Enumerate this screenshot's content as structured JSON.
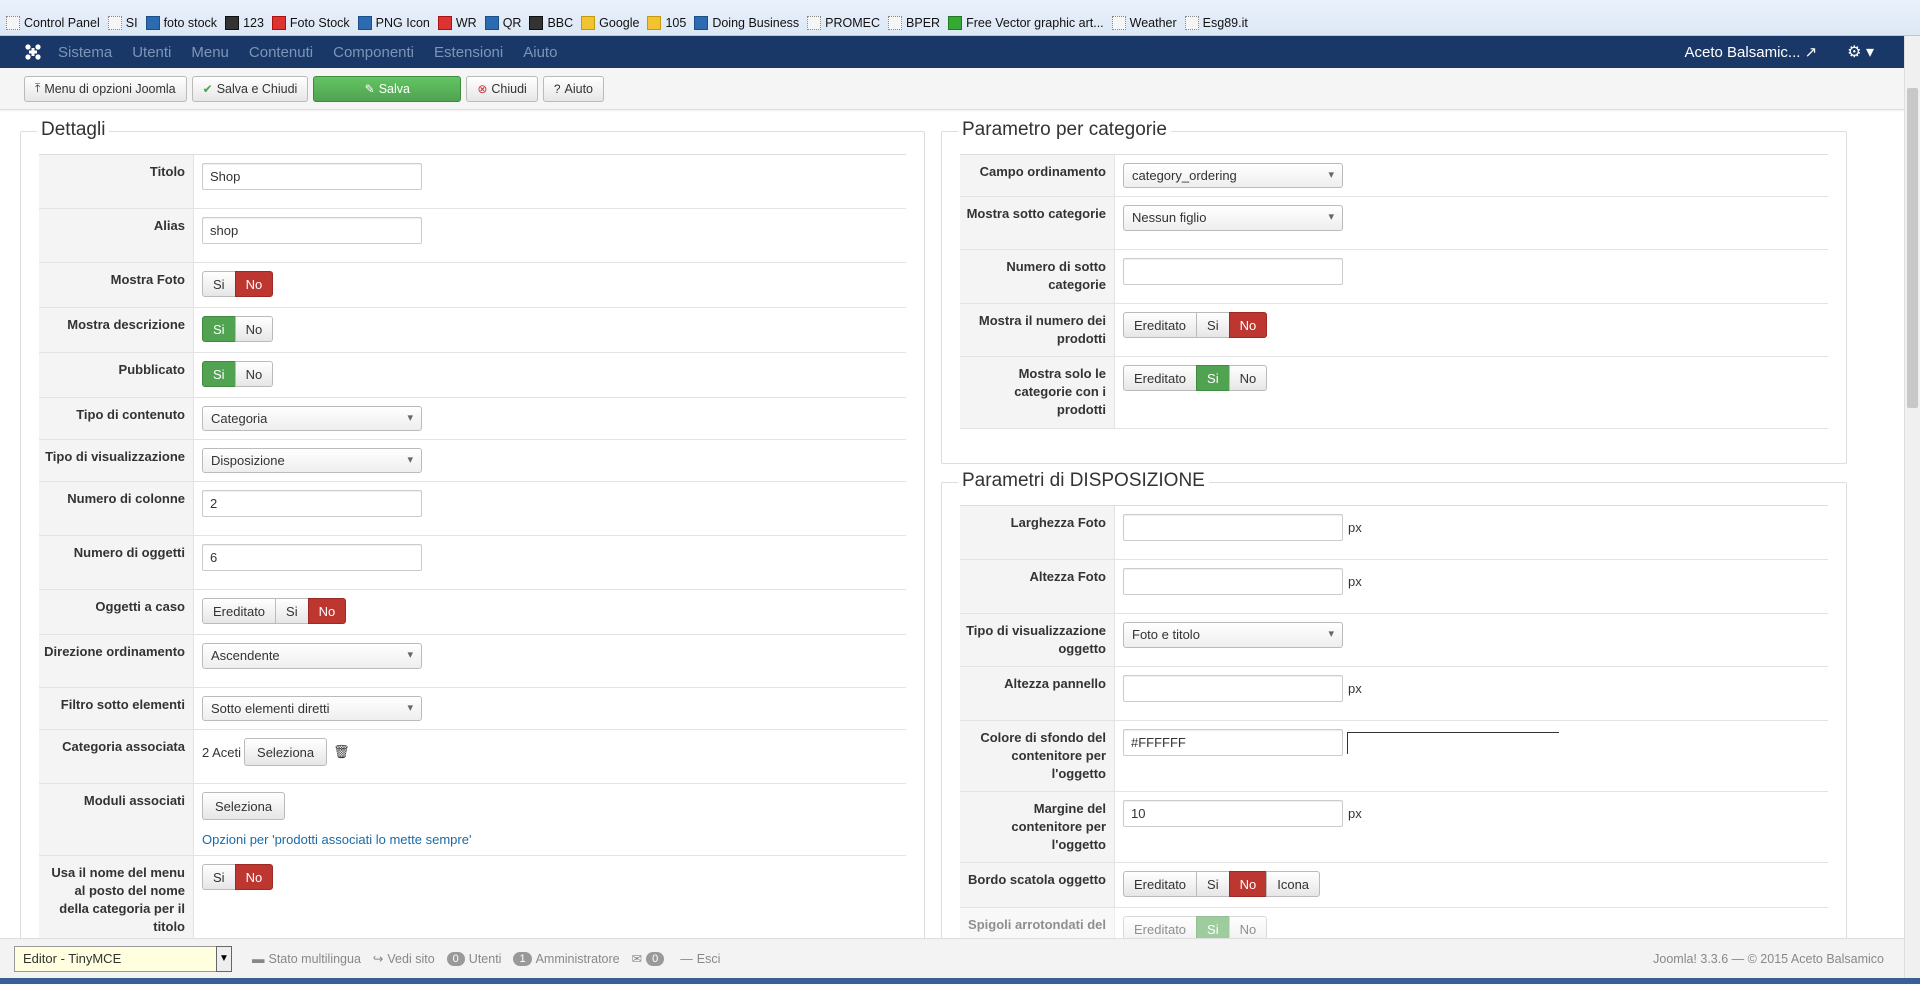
{
  "bookmarks": [
    "Control Panel",
    "SI",
    "foto stock",
    "123",
    "Foto Stock",
    "PNG Icon",
    "WR",
    "QR",
    "BBC",
    "Google",
    "105",
    "Doing Business",
    "PROMEC",
    "BPER",
    "Free Vector graphic art...",
    "Weather",
    "Esg89.it"
  ],
  "nav": {
    "items": [
      "Sistema",
      "Utenti",
      "Menu",
      "Contenuti",
      "Componenti",
      "Estensioni",
      "Aiuto"
    ],
    "site_name": "Aceto Balsamic...",
    "external_icon": "↗",
    "gear_icon": "⚙ ▾"
  },
  "toolbar": {
    "options_label": "Menu di opzioni Joomla",
    "save_close_label": "Salva e Chiudi",
    "save_label": "Salva",
    "close_label": "Chiudi",
    "help_label": "Aiuto"
  },
  "details": {
    "legend": "Dettagli",
    "titolo_label": "Titolo",
    "titolo_value": "Shop",
    "alias_label": "Alias",
    "alias_value": "shop",
    "mostra_foto_label": "Mostra Foto",
    "mostra_desc_label": "Mostra descrizione",
    "pubblicato_label": "Pubblicato",
    "tipo_contenuto_label": "Tipo di contenuto",
    "tipo_contenuto_value": "Categoria",
    "tipo_vis_label": "Tipo di visualizzazione",
    "tipo_vis_value": "Disposizione",
    "num_colonne_label": "Numero di colonne",
    "num_colonne_value": "2",
    "num_oggetti_label": "Numero di oggetti",
    "num_oggetti_value": "6",
    "oggetti_caso_label": "Oggetti a caso",
    "direzione_label": "Direzione ordinamento",
    "direzione_value": "Ascendente",
    "filtro_label": "Filtro sotto elementi",
    "filtro_value": "Sotto elementi diretti",
    "categoria_label": "Categoria associata",
    "categoria_value": "2 Aceti",
    "seleziona": "Seleziona",
    "moduli_label": "Moduli associati",
    "moduli_link": "Opzioni per 'prodotti associati lo mette sempre'",
    "usa_nome_label": "Usa il nome del menu al posto del nome della categoria per il titolo"
  },
  "toggles": {
    "si": "Si",
    "no": "No",
    "ereditato": "Ereditato",
    "icona": "Icona"
  },
  "category_params": {
    "legend": "Parametro per categorie",
    "campo_label": "Campo ordinamento",
    "campo_value": "category_ordering",
    "mostra_sotto_label": "Mostra sotto categorie",
    "mostra_sotto_value": "Nessun figlio",
    "numero_sotto_label": "Numero di sotto categorie",
    "numero_sotto_value": "",
    "mostra_numero_label": "Mostra il numero dei prodotti",
    "mostra_solo_label": "Mostra solo le categorie con i prodotti"
  },
  "layout_params": {
    "legend": "Parametri di DISPOSIZIONE",
    "larghezza_label": "Larghezza Foto",
    "larghezza_value": "",
    "altezza_label": "Altezza Foto",
    "altezza_value": "",
    "tipo_vis_ogg_label": "Tipo di visualizzazione oggetto",
    "tipo_vis_ogg_value": "Foto e titolo",
    "altezza_pannello_label": "Altezza pannello",
    "altezza_pannello_value": "",
    "colore_label": "Colore di sfondo del contenitore per l'oggetto",
    "colore_value": "#FFFFFF",
    "margine_label": "Margine del contenitore per l'oggetto",
    "margine_value": "10",
    "bordo_label": "Bordo scatola oggetto",
    "spigoli_label": "Spigoli arrotondati del",
    "unit": "px"
  },
  "status": {
    "editor": "Editor - TinyMCE",
    "multilingua": "Stato multilingua",
    "vedi_sito": "Vedi sito",
    "utenti_count": "0",
    "utenti": "Utenti",
    "admin_count": "1",
    "admin": "Amministratore",
    "msg_count": "0",
    "esci": "Esci",
    "version": "Joomla! 3.3.6  —  © 2015 Aceto Balsamico"
  },
  "colors": {
    "navbar": "#1a3867",
    "success": "#51a351",
    "danger": "#bd362f",
    "link": "#1b6aa5"
  }
}
